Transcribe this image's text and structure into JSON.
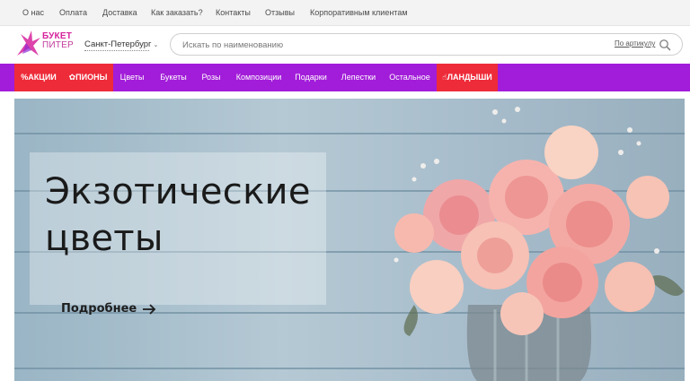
{
  "topbar": {
    "links": [
      "О нас",
      "Оплата",
      "Доставка",
      "Как заказать?",
      "Контакты",
      "Отзывы",
      "Корпоративным клиентам"
    ]
  },
  "header": {
    "logo_line1": "БУКЕТ",
    "logo_line2": "ПИТЕР",
    "city": "Санкт-Петербург",
    "search_placeholder": "Искать по наименованию",
    "by_article": "По артикулу"
  },
  "nav": {
    "items": [
      "АКЦИИ",
      "ПИОНЫ",
      "Цветы",
      "Букеты",
      "Розы",
      "Композиции",
      "Подарки",
      "Лепестки",
      "Остальное",
      "ЛАНДЫШИ"
    ]
  },
  "banner": {
    "headline_line1": "Экзотические",
    "headline_line2": "цветы",
    "more_label": "Подробнее"
  },
  "colors": {
    "nav_bg": "#a21dd9",
    "promo_red": "#ee2b39",
    "logo_pink": "#d6239c"
  },
  "icons": [
    "logo-mark",
    "chevron-down",
    "search",
    "percent",
    "flower",
    "arrow-right",
    "thumbs-up"
  ]
}
